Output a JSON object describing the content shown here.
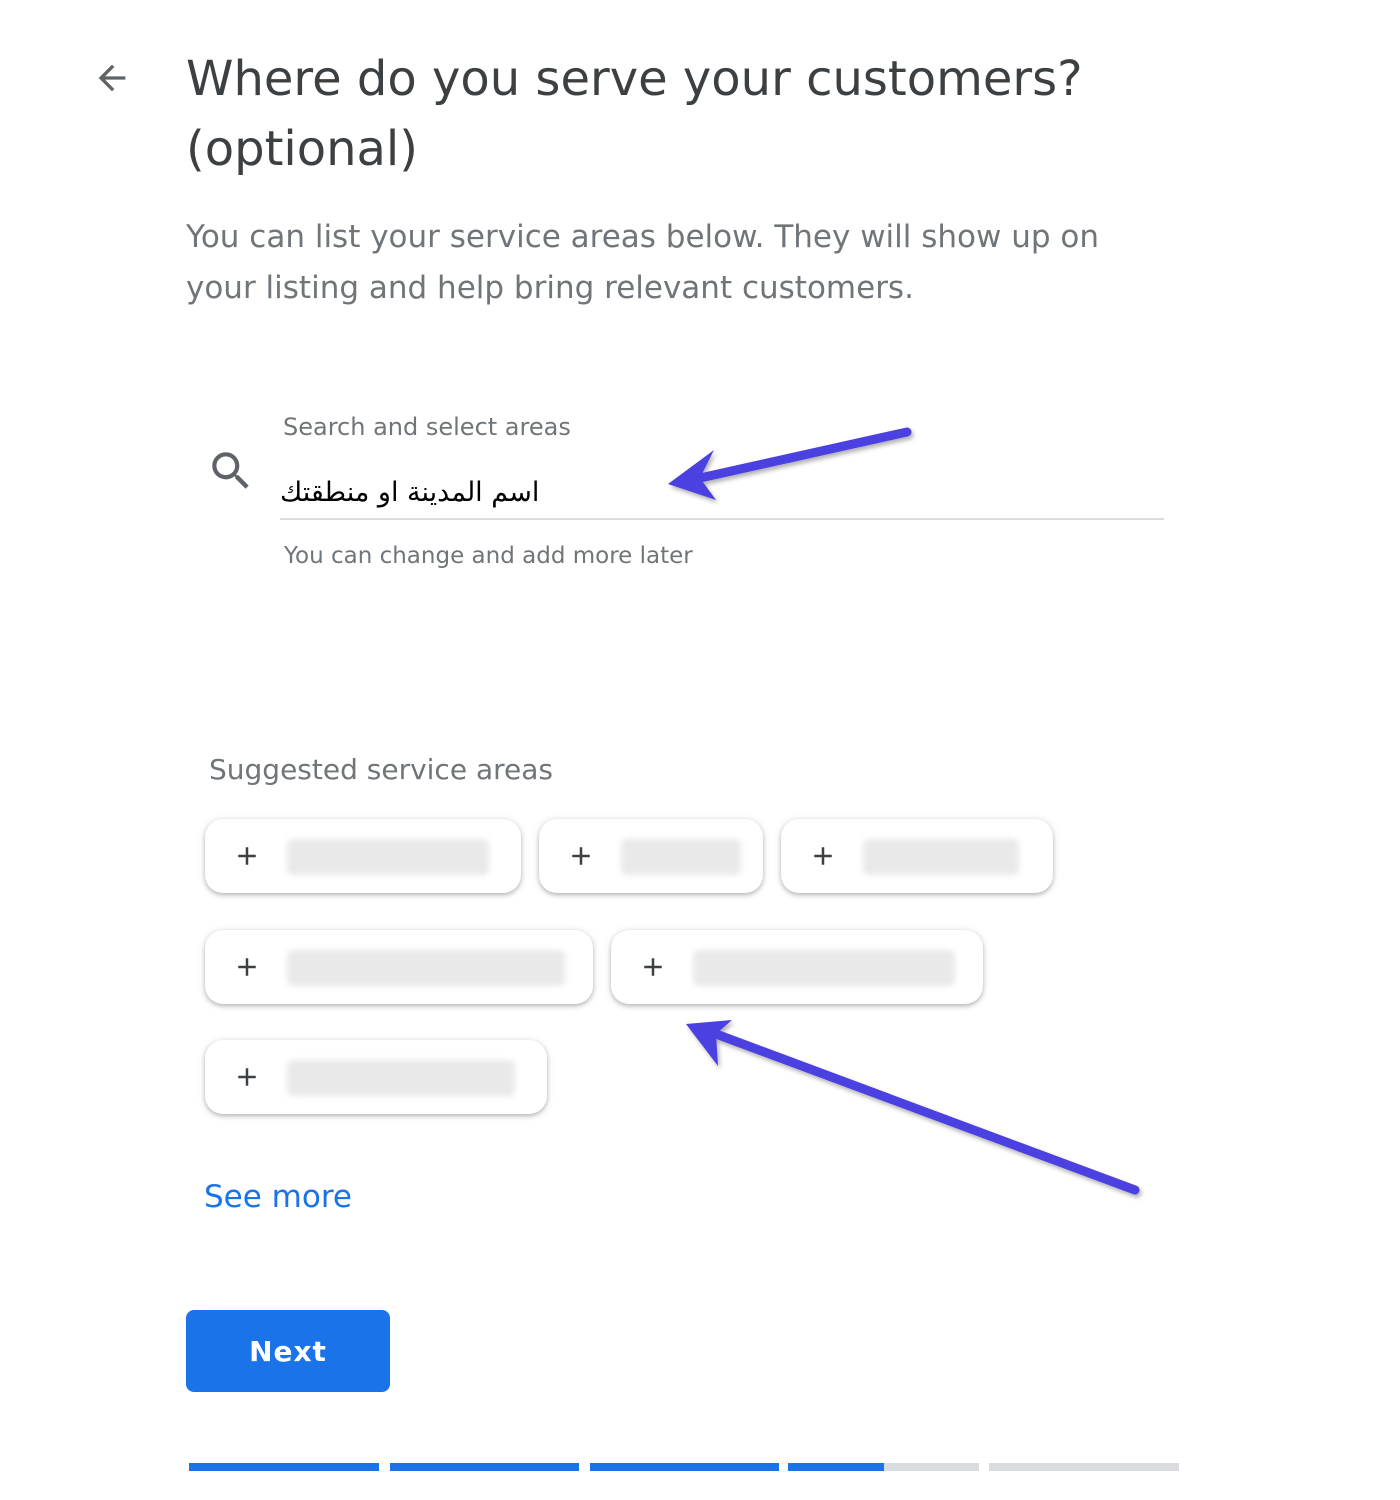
{
  "header": {
    "title_line1": "Where do you serve your customers?",
    "title_line2": "(optional)",
    "subtitle_line1": "You can list your service areas below. They will show up on",
    "subtitle_line2": "your listing and help bring relevant customers."
  },
  "search": {
    "label": "Search and select areas",
    "value": "اسم المدينة او منطقتك",
    "helper": "You can change and add more later",
    "icon": "search-icon"
  },
  "suggestions": {
    "title": "Suggested service areas",
    "chip_icon": "plus-icon",
    "chip_labels_visible": false,
    "chip_count": 6
  },
  "see_more_label": "See more",
  "next_label": "Next",
  "progress": {
    "segments": [
      1.0,
      1.0,
      1.0,
      0.5,
      0.0
    ],
    "fill_color": "#1a73e8",
    "track_color": "#dadce0"
  },
  "annotation_arrow_color": "#4b3fe0"
}
